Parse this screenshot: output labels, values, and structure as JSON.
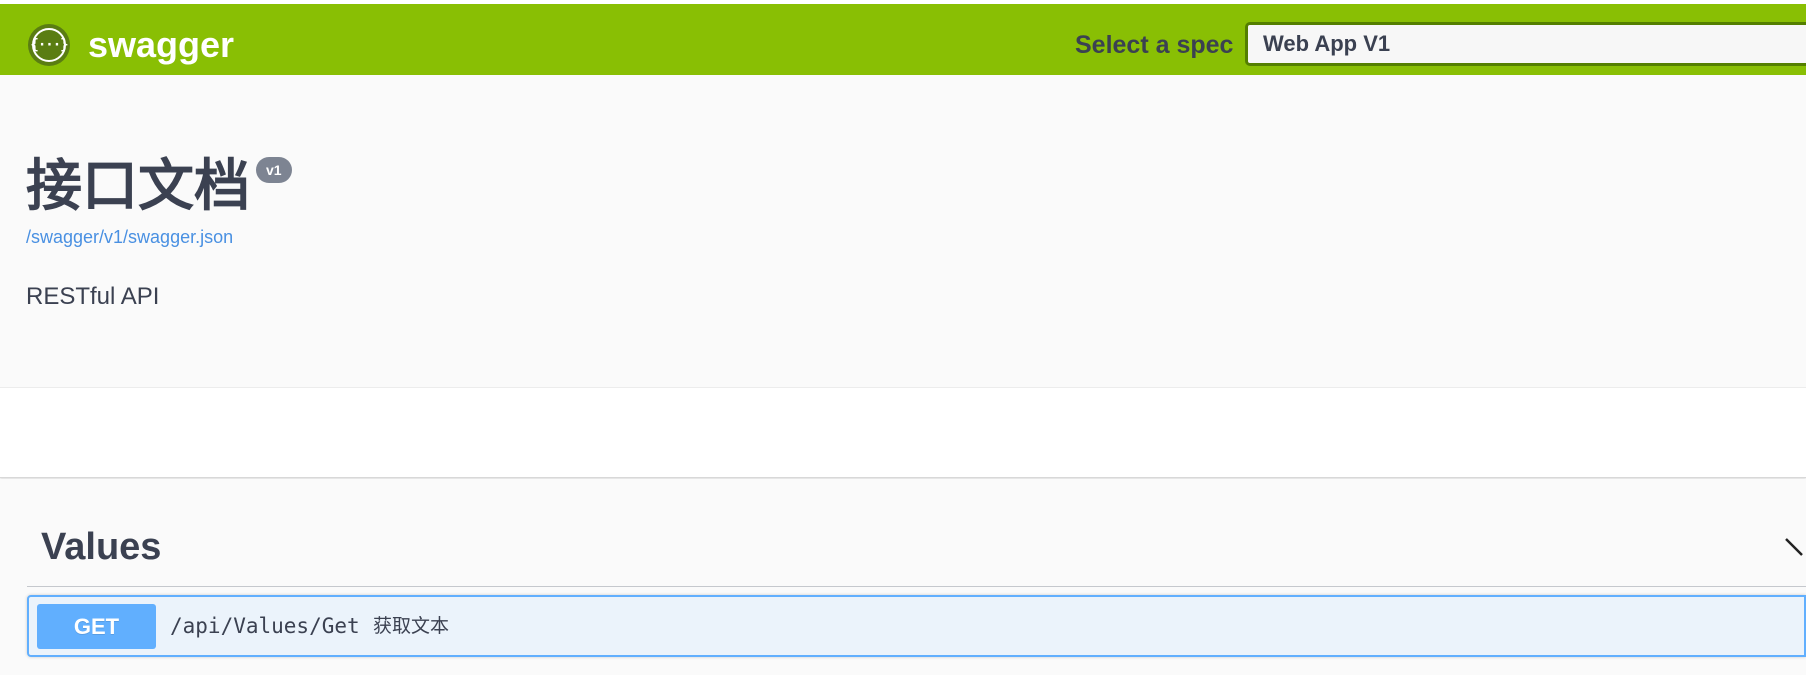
{
  "topbar": {
    "brand": "swagger",
    "logo_glyph": "{···}",
    "spec_label": "Select a spec",
    "spec_value": "Web App V1",
    "color": "#89bf04"
  },
  "info": {
    "title": "接口文档",
    "version": "v1",
    "spec_url": "/swagger/v1/swagger.json",
    "description": "RESTful API"
  },
  "tags": [
    {
      "name": "Values",
      "operations": [
        {
          "method": "GET",
          "path": "/api/Values/Get",
          "summary": "获取文本",
          "color": "#61affe"
        }
      ]
    }
  ]
}
